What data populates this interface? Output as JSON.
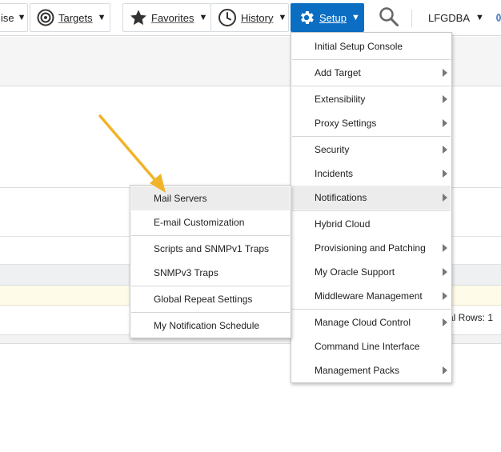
{
  "toolbar": {
    "enterprise_partial": "ise",
    "targets": "Targets",
    "favorites": "Favorites",
    "history": "History",
    "setup": "Setup",
    "user": "LFGDBA"
  },
  "setup_menu": {
    "items": [
      {
        "label": "Initial Setup Console",
        "submenu": false
      },
      {
        "label": "Add Target",
        "submenu": true
      },
      {
        "label": "Extensibility",
        "submenu": true
      },
      {
        "label": "Proxy Settings",
        "submenu": true
      },
      {
        "label": "Security",
        "submenu": true
      },
      {
        "label": "Incidents",
        "submenu": true
      },
      {
        "label": "Notifications",
        "submenu": true,
        "highlighted": true
      },
      {
        "label": "Hybrid Cloud",
        "submenu": false
      },
      {
        "label": "Provisioning and Patching",
        "submenu": true
      },
      {
        "label": "My Oracle Support",
        "submenu": true
      },
      {
        "label": "Middleware Management",
        "submenu": true
      },
      {
        "label": "Manage Cloud Control",
        "submenu": true
      },
      {
        "label": "Command Line Interface",
        "submenu": false
      },
      {
        "label": "Management Packs",
        "submenu": true
      }
    ]
  },
  "notifications_menu": {
    "items": [
      {
        "label": "Mail Servers",
        "highlighted": true
      },
      {
        "label": "E-mail Customization"
      },
      {
        "label": "Scripts and SNMPv1 Traps"
      },
      {
        "label": "SNMPv3 Traps"
      },
      {
        "label": "Global Repeat Settings"
      },
      {
        "label": "My Notification Schedule"
      }
    ]
  },
  "page": {
    "total_rows_partial": "al Rows: 1"
  },
  "icons": {
    "targets": "target-icon",
    "favorites": "star-icon",
    "history": "clock-icon",
    "setup": "gear-icon",
    "search": "search-icon",
    "annotation": "pointer-arrow"
  },
  "colors": {
    "setup_accent": "#0b6ec2",
    "annotation_arrow": "#f0b429",
    "menu_highlight": "#ececec"
  }
}
